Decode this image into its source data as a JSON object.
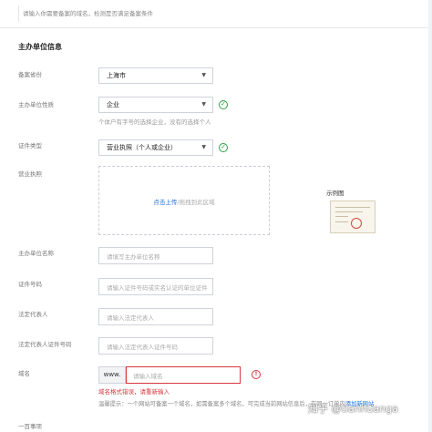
{
  "top_hint": "请输入你需要备案的域名，检测是否满足备案条件",
  "section_title": "主办单位信息",
  "fields": {
    "province": {
      "label": "备案省份",
      "value": "上海市"
    },
    "unit_nature": {
      "label": "主办单位性质",
      "value": "企业",
      "hint": "个体户有字号的选择企业，没有的选择个人"
    },
    "cert_type": {
      "label": "证件类型",
      "value": "营业执照（个人或企业）"
    },
    "business_license": {
      "label": "营业执照",
      "upload_link": "点击上传",
      "upload_rest": "/拖拽到此区域",
      "sample_label": "示例图"
    },
    "unit_name": {
      "label": "主办单位名称",
      "placeholder": "请填写主办单位名称"
    },
    "cert_number": {
      "label": "证件号码",
      "placeholder": "请输入证件号码或实名认证的单位证件"
    },
    "legal_rep": {
      "label": "法定代表人",
      "placeholder": "请输入法定代表人"
    },
    "legal_rep_cert": {
      "label": "法定代表人证件号码",
      "placeholder": "请输入法定代表人证件号码"
    },
    "domain": {
      "label": "域名",
      "prefix": "www.",
      "placeholder": "请输入域名",
      "error": "域名格式错误，请重新输入",
      "warm_tip": "温馨提示：一个网站可备案一个域名，如需备案多个域名，可完成当前网站信息后，在同一订单内",
      "warm_link": "添加新网站"
    },
    "cut_off_label": "一百事项"
  },
  "watermark": "知乎 @tianhuanga",
  "colors": {
    "accent": "#1a6fd6",
    "success": "#2fa044",
    "error": "#d9363e"
  },
  "icons": [
    "caret-down-icon",
    "check-circle-icon",
    "error-circle-icon"
  ]
}
